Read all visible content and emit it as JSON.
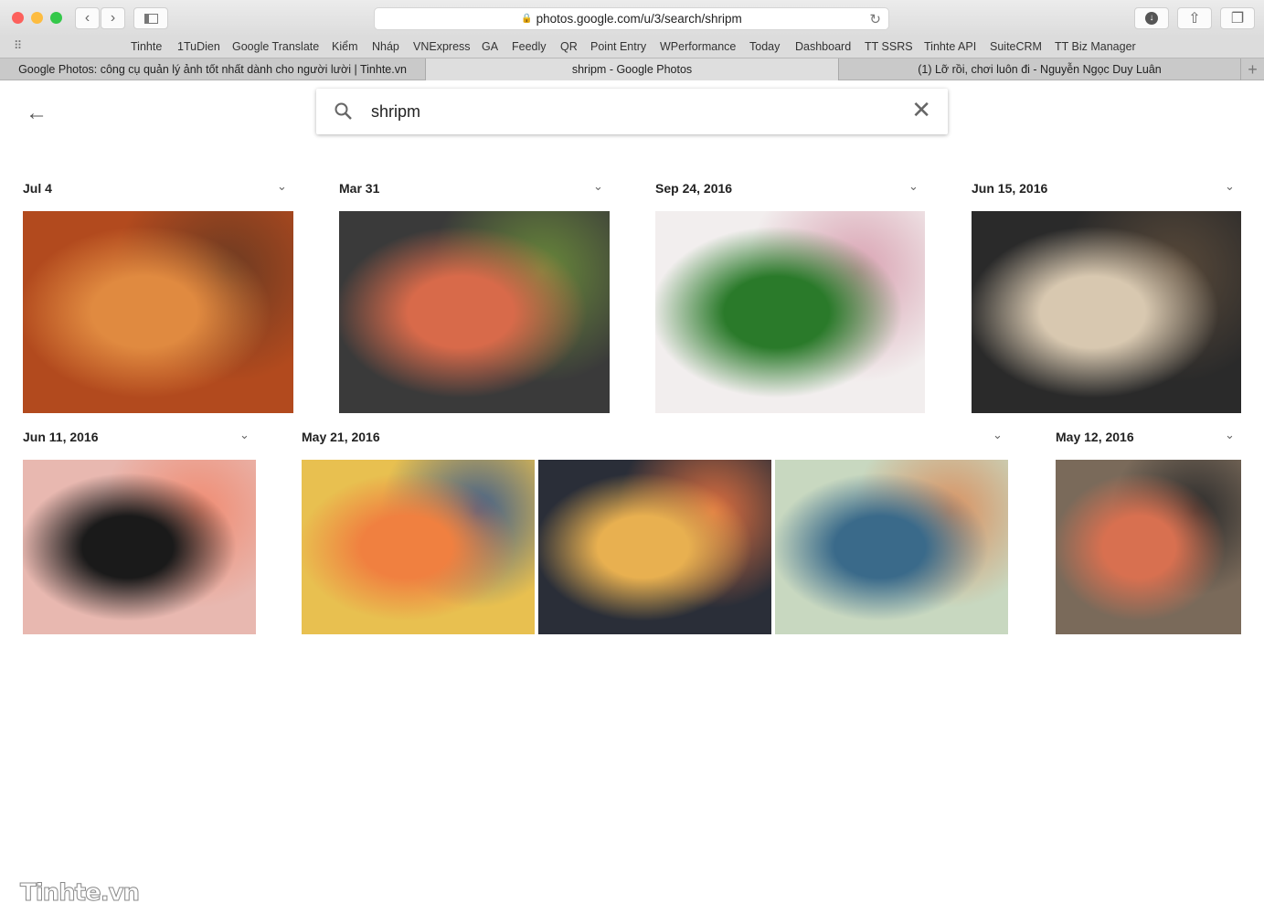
{
  "browser": {
    "url": "photos.google.com/u/3/search/shripm",
    "bookmarks": [
      "Tinhte",
      "1TuDien",
      "Google Translate",
      "Kiểm",
      "Nháp",
      "VNExpress",
      "GA",
      "Feedly",
      "QR",
      "Point Entry",
      "WPerformance",
      "Today",
      "Dashboard",
      "TT SSRS",
      "Tinhte API",
      "SuiteCRM",
      "TT Biz Manager"
    ],
    "tabs": [
      {
        "label": "Google Photos: công cụ quản lý ảnh tốt nhất dành cho người lười | Tinhte.vn"
      },
      {
        "label": "shripm - Google Photos",
        "active": true
      },
      {
        "label": "(1) Lỡ rồi, chơi luôn đi - Nguyễn Ngọc Duy Luân"
      }
    ]
  },
  "search": {
    "value": "shripm"
  },
  "groups": [
    {
      "date": "Jul 4",
      "photos": [
        {
          "colors": [
            "#b24a1e",
            "#e08a40",
            "#6a3a22"
          ]
        }
      ]
    },
    {
      "date": "Mar 31",
      "photos": [
        {
          "colors": [
            "#3a3a3a",
            "#d86a4a",
            "#6a8a3a"
          ]
        }
      ]
    },
    {
      "date": "Sep 24, 2016",
      "photos": [
        {
          "colors": [
            "#f2eeee",
            "#2a7a2a",
            "#d8a0b0"
          ]
        }
      ]
    },
    {
      "date": "Jun 15, 2016",
      "photos": [
        {
          "colors": [
            "#2a2a2a",
            "#d8c8b0",
            "#5a4a3a"
          ]
        }
      ]
    },
    {
      "date": "Jun 11, 2016",
      "photos": [
        {
          "colors": [
            "#e8b8b0",
            "#1a1a1a",
            "#f08a70"
          ]
        }
      ]
    },
    {
      "date": "May 21, 2016",
      "photos": [
        {
          "colors": [
            "#e8c050",
            "#f08040",
            "#3a5a8a"
          ]
        },
        {
          "colors": [
            "#2a2e38",
            "#e8b050",
            "#e07040"
          ]
        },
        {
          "colors": [
            "#c8d8c0",
            "#3a6a8a",
            "#d89060"
          ]
        }
      ]
    },
    {
      "date": "May 12, 2016",
      "photos": [
        {
          "colors": [
            "#7a6a5a",
            "#d87050",
            "#2a2a2a"
          ]
        }
      ]
    }
  ],
  "watermark": "Tinhte.vn"
}
